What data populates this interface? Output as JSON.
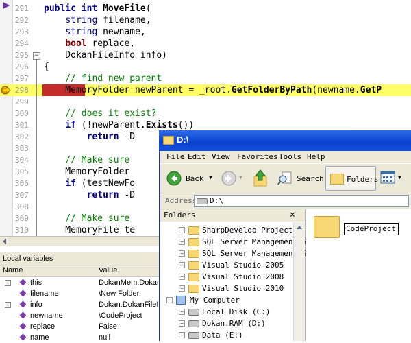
{
  "editor": {
    "lines": [
      {
        "n": "291",
        "html": "<span class='kw'>public</span> <span class='kw'>int</span> <span class='mt'>MoveFile</span>("
      },
      {
        "n": "292",
        "html": "    <span class='str'>string</span> filename,"
      },
      {
        "n": "293",
        "html": "    <span class='str'>string</span> newname,"
      },
      {
        "n": "294",
        "html": "    <span class='type'>bool</span> replace,"
      },
      {
        "n": "295",
        "html": "    DokanFileInfo info)"
      },
      {
        "n": "296",
        "html": "{"
      },
      {
        "n": "297",
        "html": "    <span class='cm'>// find new parent</span>"
      },
      {
        "n": "298",
        "html": "    MemoryFolder newParent = _root.<span class='mt'>GetFolderByPath</span>(newname.<span class='mt'>GetP</span>"
      },
      {
        "n": "299",
        "html": ""
      },
      {
        "n": "300",
        "html": "    <span class='cm'>// does it exist?</span>"
      },
      {
        "n": "301",
        "html": "    <span class='kw'>if</span> (!newParent.<span class='mt'>Exists</span>())"
      },
      {
        "n": "302",
        "html": "        <span class='kw'>return</span> -D"
      },
      {
        "n": "303",
        "html": ""
      },
      {
        "n": "304",
        "html": "    <span class='cm'>// Make sure</span>"
      },
      {
        "n": "305",
        "html": "    MemoryFolder"
      },
      {
        "n": "306",
        "html": "    <span class='kw'>if</span> (testNewFo"
      },
      {
        "n": "307",
        "html": "        <span class='kw'>return</span> -D"
      },
      {
        "n": "308",
        "html": ""
      },
      {
        "n": "309",
        "html": "    <span class='cm'>// Make sure</span>"
      },
      {
        "n": "310",
        "html": "    MemoryFile te"
      }
    ]
  },
  "locals": {
    "title": "Local variables",
    "col_name": "Name",
    "col_value": "Value",
    "rows": [
      {
        "name": "this",
        "value": "DokanMem.DokanI",
        "expandable": true
      },
      {
        "name": "filename",
        "value": "\\New Folder",
        "expandable": false
      },
      {
        "name": "info",
        "value": "Dokan.DokanFileIn",
        "expandable": true
      },
      {
        "name": "newname",
        "value": "\\CodeProject",
        "expandable": false
      },
      {
        "name": "replace",
        "value": "False",
        "expandable": false
      },
      {
        "name": "name",
        "value": "null",
        "expandable": false
      }
    ]
  },
  "explorer": {
    "title": "D:\\",
    "menus": [
      "File",
      "Edit",
      "View",
      "Favorites",
      "Tools",
      "Help"
    ],
    "toolbar": {
      "back": "Back",
      "search": "Search",
      "folders": "Folders"
    },
    "address_label": "Address",
    "address_value": "D:\\",
    "folders_header": "Folders",
    "folders_close": "×",
    "tree": [
      {
        "label": "SharpDevelop Projects",
        "kind": "folder",
        "indent": 1,
        "expand": "+"
      },
      {
        "label": "SQL Server Management Sı",
        "kind": "folder",
        "indent": 1,
        "expand": "+"
      },
      {
        "label": "SQL Server Management Sı",
        "kind": "folder",
        "indent": 1,
        "expand": "+"
      },
      {
        "label": "Visual Studio 2005",
        "kind": "folder",
        "indent": 1,
        "expand": "+"
      },
      {
        "label": "Visual Studio 2008",
        "kind": "folder",
        "indent": 1,
        "expand": "+"
      },
      {
        "label": "Visual Studio 2010",
        "kind": "folder",
        "indent": 1,
        "expand": "+"
      },
      {
        "label": "My Computer",
        "kind": "computer",
        "indent": 0,
        "expand": "−"
      },
      {
        "label": "Local Disk (C:)",
        "kind": "drive",
        "indent": 1,
        "expand": "+"
      },
      {
        "label": "Dokan.RAM (D:)",
        "kind": "drive",
        "indent": 1,
        "expand": "+"
      },
      {
        "label": "Data (E:)",
        "kind": "drive",
        "indent": 1,
        "expand": "+"
      }
    ],
    "rename_value": "CodeProject"
  },
  "colors": {
    "highlight": "#ffff66",
    "breakpoint": "#c62b2b",
    "titlebar": "#0a3fcf"
  }
}
